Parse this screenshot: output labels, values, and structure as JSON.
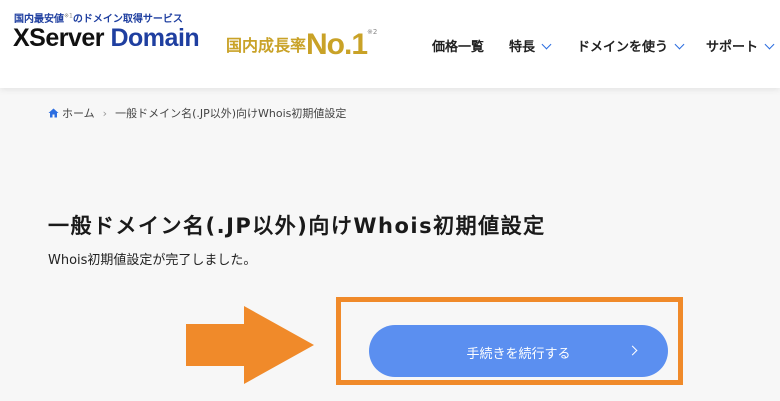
{
  "header": {
    "tagline_first": "国内最安値",
    "tagline_note": "※1",
    "tagline_rest": "のドメイン取得サービス",
    "logo_x": "XServer",
    "logo_domain": "Domain",
    "rank_text": "国内成長率",
    "rank_value": "No.1",
    "rank_note": "※2",
    "nav": [
      {
        "label": "価格一覧",
        "icon": "none"
      },
      {
        "label": "特長",
        "icon": "chevron-down-icon"
      },
      {
        "label": "ドメインを使う",
        "icon": "chevron-down-icon"
      },
      {
        "label": "サポート",
        "icon": "chevron-down-icon"
      }
    ]
  },
  "breadcrumb": {
    "home": "ホーム",
    "current": "一般ドメイン名(.JP以外)向けWhois初期値設定"
  },
  "main": {
    "title": "一般ドメイン名(.JP以外)向けWhois初期値設定",
    "message": "Whois初期値設定が完了しました。",
    "continue_button": "手続きを続行する"
  },
  "colors": {
    "brand_blue": "#1f3fa0",
    "gold": "#c9a227",
    "accent_blue": "#2b6de0",
    "button_blue": "#5b8ff0",
    "annotation_orange": "#f08a2a"
  }
}
